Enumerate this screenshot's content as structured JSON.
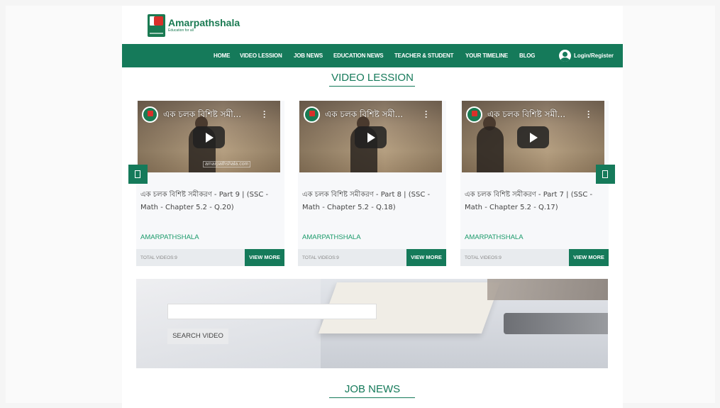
{
  "site": {
    "name": "Amarpathshala",
    "tagline": "Education for all"
  },
  "nav": {
    "items": [
      {
        "label": "HOME"
      },
      {
        "label": "VIDEO LESSION"
      },
      {
        "label": "JOB NEWS"
      },
      {
        "label": "EDUCATION NEWS"
      },
      {
        "label": "TEACHER & STUDENT"
      },
      {
        "label": "YOUR TIMELINE"
      },
      {
        "label": "BLOG"
      }
    ],
    "login_label": "Login/Register"
  },
  "video_section": {
    "title": "VIDEO LESSION",
    "cards": [
      {
        "thumb_title": "এক চলক বিশিষ্ট সমী...",
        "title": "এক চলক বিশিষ্ট সমীকরণ - Part 9 | (SSC - Math - Chapter 5.2 - Q.20)",
        "author": "AMARPATHSHALA",
        "total": "TOTAL VIDEOS:9",
        "button": "VIEW MORE",
        "watermark": "amarpathshala.com"
      },
      {
        "thumb_title": "এক চলক বিশিষ্ট সমী...",
        "title": "এক চলক বিশিষ্ট সমীকরণ - Part 8 | (SSC - Math - Chapter 5.2 - Q.18)",
        "author": "AMARPATHSHALA",
        "total": "TOTAL VIDEOS:9",
        "button": "VIEW MORE",
        "watermark": ""
      },
      {
        "thumb_title": "এক চলক বিশিষ্ট সমী...",
        "title": "এক চলক বিশিষ্ট সমীকরণ - Part 7 | (SSC - Math - Chapter 5.2 - Q.17)",
        "author": "AMARPATHSHALA",
        "total": "TOTAL VIDEOS:9",
        "button": "VIEW MORE",
        "watermark": ""
      }
    ]
  },
  "search": {
    "value": "",
    "button": "SEARCH VIDEO"
  },
  "job_section": {
    "title": "JOB NEWS"
  },
  "colors": {
    "brand_green": "#157a5a",
    "link_green": "#1a9a6a"
  }
}
